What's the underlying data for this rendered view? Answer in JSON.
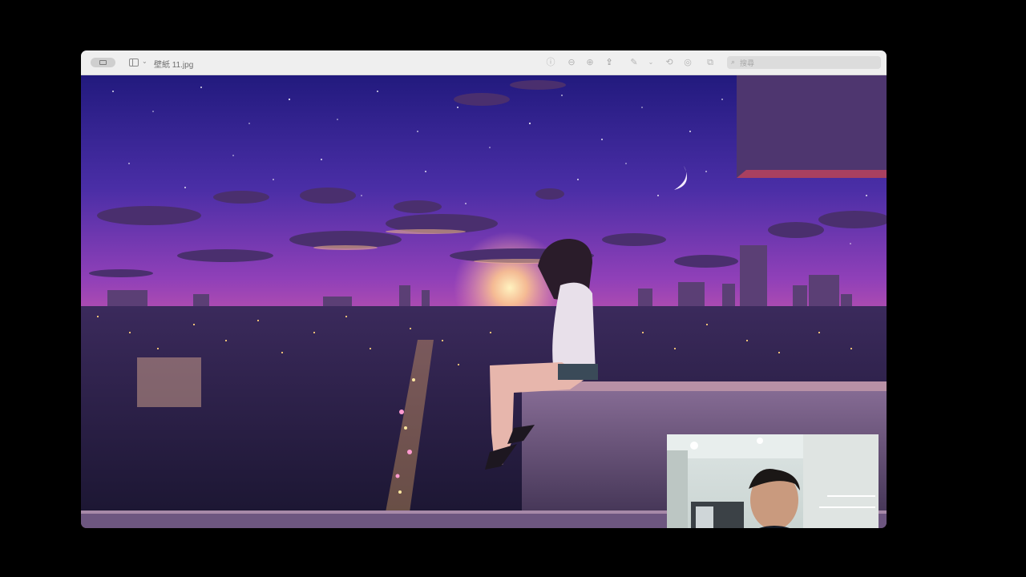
{
  "window": {
    "title": "壁紙 11.jpg",
    "search_placeholder": "搜尋"
  },
  "toolbar": {
    "icons": [
      "sidebar-toggle-icon",
      "chevron-down-icon",
      "info-icon",
      "zoom-out-icon",
      "zoom-in-icon",
      "share-icon",
      "markup-pen-icon",
      "chevron-down-icon",
      "rotate-icon",
      "annotate-icon",
      "resize-icon",
      "search-icon"
    ]
  },
  "image": {
    "description_colors": {
      "sky_top": "#2a1f8a",
      "sky_mid": "#8a3fb8",
      "horizon": "#f08ab0",
      "sun": "#ffd08a"
    }
  },
  "webcam": {
    "label": ""
  }
}
